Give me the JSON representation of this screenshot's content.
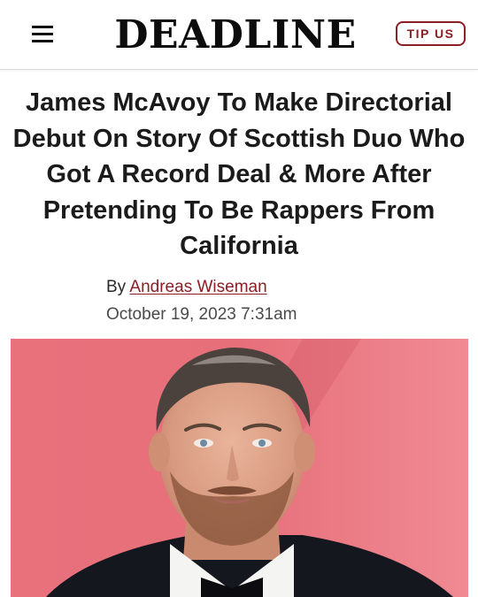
{
  "header": {
    "menu_icon": "hamburger-menu-icon",
    "logo_text": "DEADLINE",
    "tip_label": "TIP US",
    "accent_color": "#8a1f24"
  },
  "article": {
    "headline": "James McAvoy To Make Directorial Debut On Story Of Scottish Duo Who Got A Record Deal & More After Pretending To Be Rappers From California",
    "byline_prefix": "By",
    "author": "Andreas Wiseman",
    "date": "October 19, 2023 7:31am"
  },
  "hero_image": {
    "subject": "headshot-photo",
    "background_color": "#e8727c"
  }
}
